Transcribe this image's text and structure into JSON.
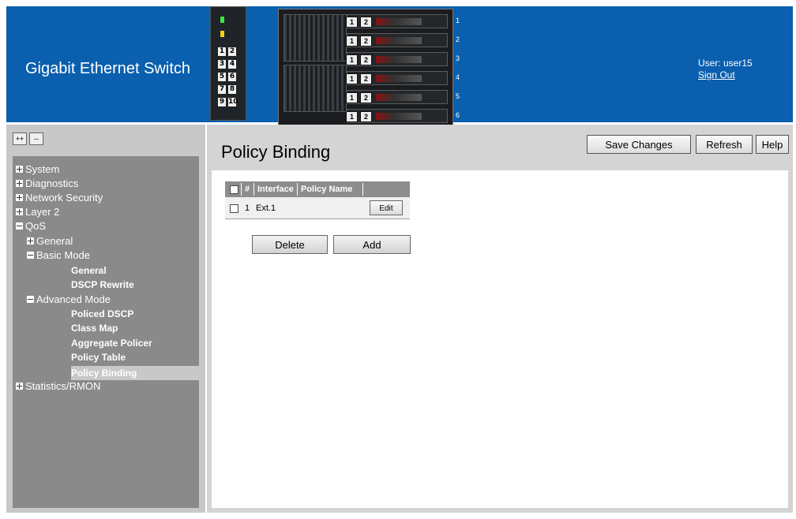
{
  "header": {
    "title": "Gigabit Ethernet Switch",
    "user_label": "User: user15",
    "sign_out": "Sign Out"
  },
  "small_switch": {
    "ports": [
      "1",
      "2",
      "3",
      "4",
      "5",
      "6",
      "7",
      "8",
      "9",
      "10"
    ]
  },
  "big_switch": {
    "slots": [
      {
        "a": "1",
        "b": "2",
        "index": "1"
      },
      {
        "a": "1",
        "b": "2",
        "index": "2"
      },
      {
        "a": "1",
        "b": "2",
        "index": "3"
      },
      {
        "a": "1",
        "b": "2",
        "index": "4"
      },
      {
        "a": "1",
        "b": "2",
        "index": "5"
      },
      {
        "a": "1",
        "b": "2",
        "index": "6"
      }
    ]
  },
  "sidebar": {
    "expand_all": "++",
    "collapse_all": "--",
    "tree": {
      "system": "System",
      "diagnostics": "Diagnostics",
      "network_security": "Network Security",
      "layer2": "Layer 2",
      "qos": "QoS",
      "qos_general": "General",
      "basic_mode": "Basic Mode",
      "basic_general": "General",
      "dscp_rewrite": "DSCP Rewrite",
      "advanced_mode": "Advanced Mode",
      "policed_dscp": "Policed DSCP",
      "class_map": "Class Map",
      "aggregate_policer": "Aggregate Policer",
      "policy_table": "Policy Table",
      "policy_binding": "Policy Binding",
      "statistics": "Statistics/RMON"
    }
  },
  "main": {
    "title": "Policy Binding",
    "buttons": {
      "save": "Save Changes",
      "refresh": "Refresh",
      "help": "Help"
    },
    "table": {
      "columns": [
        "#",
        "Interface",
        "Policy Name"
      ],
      "rows": [
        {
          "num": "1",
          "interface": "Ext.1",
          "policy": "",
          "action": "Edit"
        }
      ]
    },
    "actions": {
      "delete": "Delete",
      "add": "Add"
    }
  },
  "colors": {
    "header_bg": "#0a5fae",
    "tree_bg": "#8a8a8a",
    "sidebar_bg": "#c8c8c8"
  }
}
